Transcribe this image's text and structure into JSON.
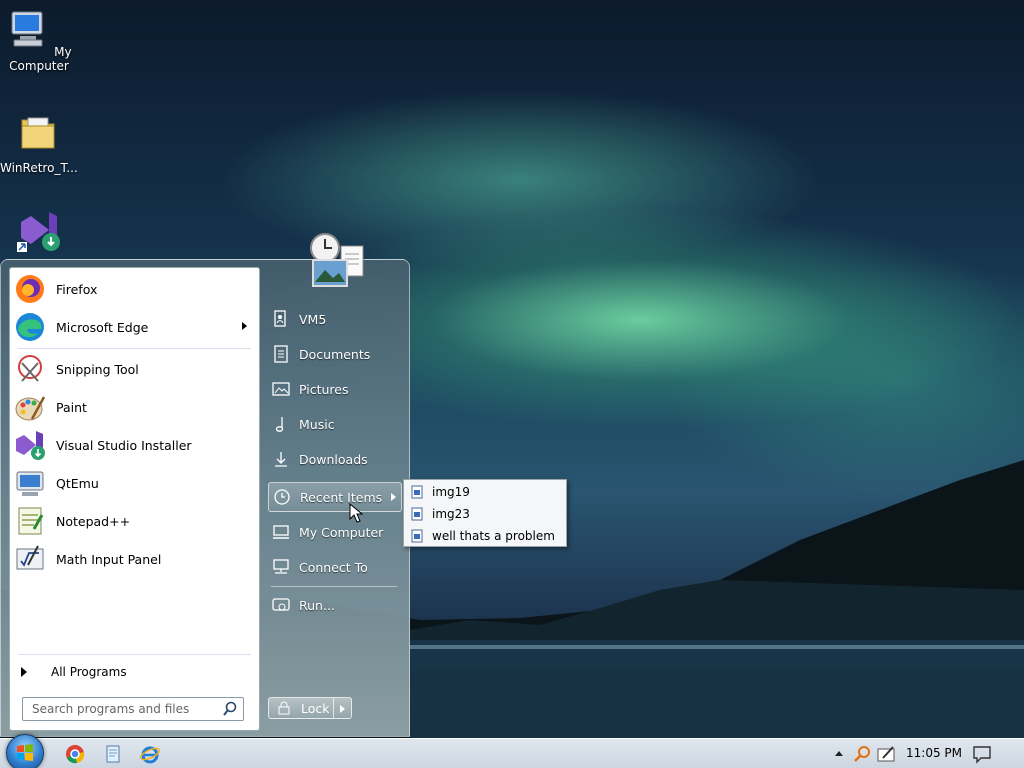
{
  "desktop": {
    "icons": [
      {
        "label": "My Computer",
        "icon": "my-computer-icon"
      },
      {
        "label": "WinRetro_T...",
        "icon": "folder-icon"
      },
      {
        "label": "",
        "icon": "visual-studio-installer-icon"
      }
    ]
  },
  "start_menu": {
    "programs": [
      {
        "label": "Firefox",
        "icon": "firefox-icon"
      },
      {
        "label": "Microsoft Edge",
        "icon": "edge-icon",
        "has_submenu": true
      },
      {
        "label": "Snipping Tool",
        "icon": "snipping-tool-icon"
      },
      {
        "label": "Paint",
        "icon": "paint-icon"
      },
      {
        "label": "Visual Studio Installer",
        "icon": "visual-studio-installer-icon"
      },
      {
        "label": "QtEmu",
        "icon": "qtemu-icon"
      },
      {
        "label": "Notepad++",
        "icon": "notepad-plus-plus-icon"
      },
      {
        "label": "Math Input Panel",
        "icon": "math-input-panel-icon"
      }
    ],
    "all_programs": "All Programs",
    "search_placeholder": "Search programs and files",
    "right_items": [
      {
        "label": "VM5",
        "icon": "user-folder-icon"
      },
      {
        "label": "Documents",
        "icon": "documents-icon"
      },
      {
        "label": "Pictures",
        "icon": "pictures-icon"
      },
      {
        "label": "Music",
        "icon": "music-icon"
      },
      {
        "label": "Downloads",
        "icon": "downloads-icon"
      },
      {
        "label": "Recent Items",
        "icon": "clock-icon",
        "has_submenu": true,
        "highlighted": true
      },
      {
        "label": "My Computer",
        "icon": "computer-icon"
      },
      {
        "label": "Connect To",
        "icon": "network-icon"
      },
      {
        "label": "Run...",
        "icon": "run-icon"
      }
    ],
    "lock_label": "Lock"
  },
  "recent_items": [
    "img19",
    "img23",
    "well thats a problem"
  ],
  "taskbar": {
    "pinned": [
      "chrome-icon",
      "notepad-icon",
      "internet-explorer-icon"
    ],
    "clock": "11:05 PM",
    "tray": [
      "show-hidden-icons-arrow",
      "search-tray-icon",
      "pen-tray-icon",
      "notification-icon"
    ]
  },
  "colors": {
    "accent": "#2f7fd0",
    "menu_left_bg": "#ffffff"
  }
}
